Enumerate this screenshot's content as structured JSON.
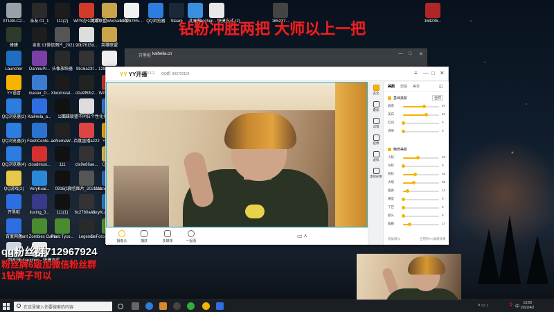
{
  "overlay": {
    "top_banner": "钻粉冲胜两把 大师以上一把",
    "fan_group": "qq粉丝群712967924",
    "line2": "粉丝牌6级加微信粉丝群",
    "line3": "1钻牌子可以"
  },
  "desktop_icons": [
    {
      "label": "XTL88-C2...",
      "color": "#9aa0a8"
    },
    {
      "label": "亲友 01_1",
      "color": "#2a2a2a"
    },
    {
      "label": "111(2)",
      "color": "#1c1c1c"
    },
    {
      "label": "WPS办公助手",
      "color": "#d23b2a"
    },
    {
      "label": "英雄联盟WeGame版",
      "color": "#c9a44b"
    },
    {
      "label": "100287E5-...",
      "color": "#f2f2f2"
    },
    {
      "label": "QQ浏览器",
      "color": "#2d7de0"
    },
    {
      "label": "Steam",
      "color": "#1b2838"
    },
    {
      "label": "此电脑",
      "color": "#3b8fe0"
    },
    {
      "label": "liuhaochen - 快捷方式 (2)",
      "color": "#e8e8e8"
    },
    {
      "label": "165237...",
      "color": "#444"
    },
    {
      "label": "164235...",
      "color": "#b02626"
    },
    {
      "label": "蜂膜",
      "color": "#2e3a2a"
    },
    {
      "label": "亲友 01",
      "color": "#1d1d1d"
    },
    {
      "label": "微信图片_2021...",
      "color": "#555"
    },
    {
      "label": "90b7615d...",
      "color": "#ddd"
    },
    {
      "label": "英雄联盟",
      "color": "#c9a44b"
    },
    {
      "label": "Launcher",
      "color": "#1f6fc0"
    },
    {
      "label": "DanmuPr...",
      "color": "#7b3fa8"
    },
    {
      "label": "头像放映器",
      "color": "#2a2a2a"
    },
    {
      "label": "9b16a23f...",
      "color": "#333"
    },
    {
      "label": "128583e8...",
      "color": "#eee"
    },
    {
      "label": "YY语音",
      "color": "#f6b400"
    },
    {
      "label": "master_D...",
      "color": "#3c7cd0"
    },
    {
      "label": "XboxInstal...",
      "color": "#1b1b1b"
    },
    {
      "label": "d2a9f5fb2...",
      "color": "#222"
    },
    {
      "label": "WPS Office",
      "color": "#d23b2a"
    },
    {
      "label": "QQ浏览器(2)",
      "color": "#2d7de0"
    },
    {
      "label": "KaiHeila_a...",
      "color": "#2d6fe0"
    },
    {
      "label": "1212",
      "color": "#111"
    },
    {
      "label": "英雄联盟不同位个性化推荐",
      "color": "#ddd"
    },
    {
      "label": "中控",
      "color": "#3b7fe0"
    },
    {
      "label": "QQ浏览器(3)",
      "color": "#2d7de0"
    },
    {
      "label": "FlashCente...",
      "color": "#2a72d0"
    },
    {
      "label": "aeNemaW...",
      "color": "#222"
    },
    {
      "label": "百度直播a222",
      "color": "#d44"
    },
    {
      "label": "YY开播",
      "color": "#f6b400"
    },
    {
      "label": "QQ浏览器(4)",
      "color": "#2d7de0"
    },
    {
      "label": "cloudmusi...",
      "color": "#d43030"
    },
    {
      "label": "111",
      "color": "#111"
    },
    {
      "label": "cfa9e86ae...",
      "color": "#333"
    },
    {
      "label": "QQ游戏",
      "color": "#e8c84a"
    },
    {
      "label": "QQ游戏(2)",
      "color": "#e8c84a"
    },
    {
      "label": "VeryKuai...",
      "color": "#2a88d8"
    },
    {
      "label": "0916(1)",
      "color": "#111"
    },
    {
      "label": "微信图片_2021111...",
      "color": "#555"
    },
    {
      "label": "Internet Explorer",
      "color": "#2a78d0"
    },
    {
      "label": "开黑啦",
      "color": "#2d6fe0"
    },
    {
      "label": "liuxing_3...",
      "color": "#3a3a8a"
    },
    {
      "label": "111(1)",
      "color": "#111"
    },
    {
      "label": "6c2780ae5...",
      "color": "#333"
    },
    {
      "label": "VeryKuai VK加速器",
      "color": "#2a88d8"
    },
    {
      "label": "百度网盘",
      "color": "#2d6fe0"
    },
    {
      "label": "Plant Zombies Game...",
      "color": "#4a8a30"
    },
    {
      "label": "Plant Tyco...",
      "color": "#4a8a30"
    },
    {
      "label": "Legends",
      "color": "#2a2a2a"
    },
    {
      "label": "GeForce Experience",
      "color": "#5aa02c"
    },
    {
      "label": "回收站",
      "color": "#cfd6e0"
    },
    {
      "label": "liuhaochen - 快捷方式",
      "color": "#e8e8e8"
    }
  ],
  "browser": {
    "tab": "开黑啦",
    "url": "kaiheila.cn"
  },
  "yy": {
    "app": "YY开播",
    "version": "1.33.1.2",
    "qq": "QQ昵: 993720159",
    "win_controls": [
      "≡",
      "—",
      "□",
      "✕"
    ],
    "toolbar": [
      {
        "label": "摄像头",
        "icon": "camera-icon"
      },
      {
        "label": "捕获",
        "icon": "capture-icon"
      },
      {
        "label": "多媒体",
        "icon": "media-icon"
      },
      {
        "label": "一起看",
        "icon": "watch-together-icon"
      }
    ],
    "side_items": [
      {
        "label": "美化",
        "icon": "beauty-icon"
      },
      {
        "label": "叠加",
        "icon": "overlay-icon"
      },
      {
        "label": "滤镜",
        "icon": "filter-icon"
      },
      {
        "label": "抠像",
        "icon": "keying-icon"
      },
      {
        "label": "虚拟",
        "icon": "avatar-icon"
      },
      {
        "label": "虚拟形象",
        "icon": "virtual-icon"
      }
    ],
    "tabs": [
      "美颜",
      "滤镜",
      "美妆"
    ],
    "section1": {
      "title": "基础美颜",
      "mode": "自然"
    },
    "section1_rows": [
      {
        "label": "磨皮",
        "value": 57
      },
      {
        "label": "美白",
        "value": 64
      },
      {
        "label": "红润",
        "value": 0
      },
      {
        "label": "清晰",
        "value": 0
      }
    ],
    "section2": {
      "title": "精修美颜"
    },
    "section2_rows": [
      {
        "label": "小脸",
        "value": 40
      },
      {
        "label": "窄脸",
        "value": 0
      },
      {
        "label": "削脸",
        "value": 33
      },
      {
        "label": "大眼",
        "value": 28
      },
      {
        "label": "瘦鼻",
        "value": 12
      },
      {
        "label": "嘴型",
        "value": 0
      },
      {
        "label": "下巴",
        "value": 0
      },
      {
        "label": "额头",
        "value": 0
      },
      {
        "label": "瘦颧",
        "value": 17
      }
    ],
    "footer_left": "恢复默认",
    "footer_right": "应用到YY美颜效果"
  },
  "taskbar": {
    "search_placeholder": "在这里输入你要搜索的内容",
    "tray_lang": "中",
    "tray_ime": "S",
    "time": "13:59",
    "date": "2022/4/2"
  }
}
